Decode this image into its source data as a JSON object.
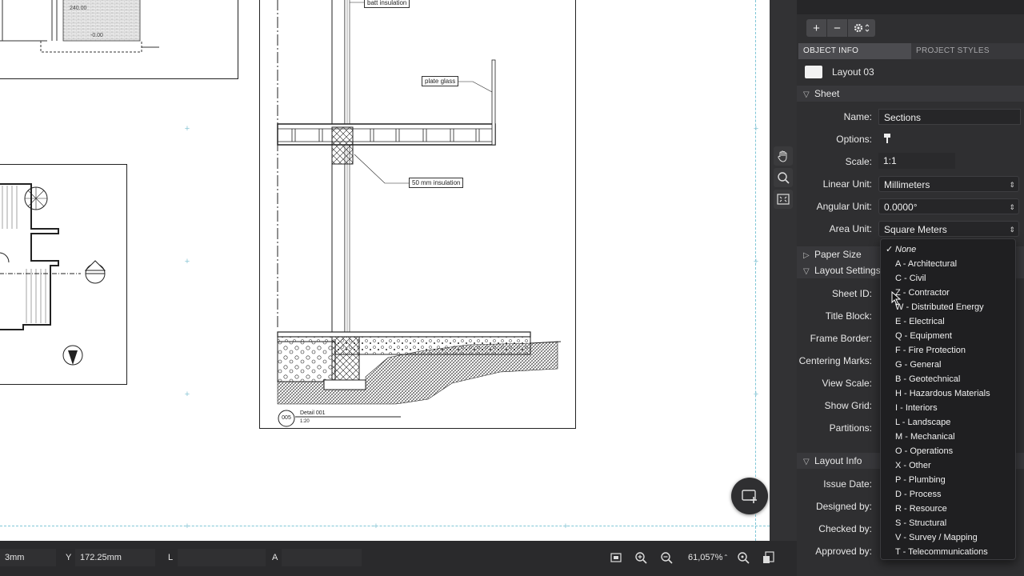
{
  "canvas": {
    "callouts": {
      "batt": "batt insulation",
      "glass": "plate glass",
      "insul50": "50 mm insulation",
      "detail_num": "005",
      "detail_title": "Detail 001",
      "detail_scale": "1:20",
      "elev1": "240.00",
      "elev2": "-0.00"
    }
  },
  "statusbar": {
    "x_value": "3mm",
    "y_label": "Y",
    "y_value": "172.25mm",
    "l_label": "L",
    "a_label": "A",
    "zoom": "61,057%"
  },
  "panel": {
    "tabs": [
      {
        "label": "OBJECT INFO",
        "active": true
      },
      {
        "label": "PROJECT STYLES",
        "active": false
      }
    ],
    "layout_name": "Layout 03",
    "sections": {
      "sheet": "Sheet",
      "paper_size": "Paper Size",
      "layout_settings": "Layout Settings",
      "layout_info": "Layout Info"
    },
    "fields": {
      "name_label": "Name:",
      "name_value": "Sections",
      "options_label": "Options:",
      "scale_label": "Scale:",
      "scale_value": "1:1",
      "linear_label": "Linear Unit:",
      "linear_value": "Millimeters",
      "angular_label": "Angular Unit:",
      "angular_value": "0.0000°",
      "area_label": "Area Unit:",
      "area_value": "Square Meters",
      "sheet_id_label": "Sheet ID:",
      "title_block_label": "Title Block:",
      "frame_border_label": "Frame Border:",
      "centering_label": "Centering Marks:",
      "view_scale_label": "View Scale:",
      "show_grid_label": "Show Grid:",
      "partitions_label": "Partitions:",
      "issue_date_label": "Issue Date:",
      "designed_label": "Designed by:",
      "checked_label": "Checked by:",
      "approved_label": "Approved by:"
    }
  },
  "dropdown": {
    "items": [
      {
        "label": "None",
        "checked": true
      },
      {
        "label": "A - Architectural"
      },
      {
        "label": "C - Civil"
      },
      {
        "label": "Z - Contractor"
      },
      {
        "label": "W - Distributed Energy"
      },
      {
        "label": "E - Electrical"
      },
      {
        "label": "Q - Equipment"
      },
      {
        "label": "F - Fire Protection"
      },
      {
        "label": "G - General"
      },
      {
        "label": "B - Geotechnical"
      },
      {
        "label": "H - Hazardous Materials"
      },
      {
        "label": "I - Interiors"
      },
      {
        "label": "L - Landscape"
      },
      {
        "label": "M - Mechanical"
      },
      {
        "label": "O - Operations"
      },
      {
        "label": "X - Other"
      },
      {
        "label": "P - Plumbing"
      },
      {
        "label": "D - Process"
      },
      {
        "label": "R - Resource"
      },
      {
        "label": "S - Structural"
      },
      {
        "label": "V - Survey / Mapping"
      },
      {
        "label": "T - Telecommunications"
      }
    ]
  },
  "colors": {
    "panel_bg": "#2f2f31",
    "guide": "#7fc6d6",
    "dropdown_bg": "#1f1f21"
  }
}
